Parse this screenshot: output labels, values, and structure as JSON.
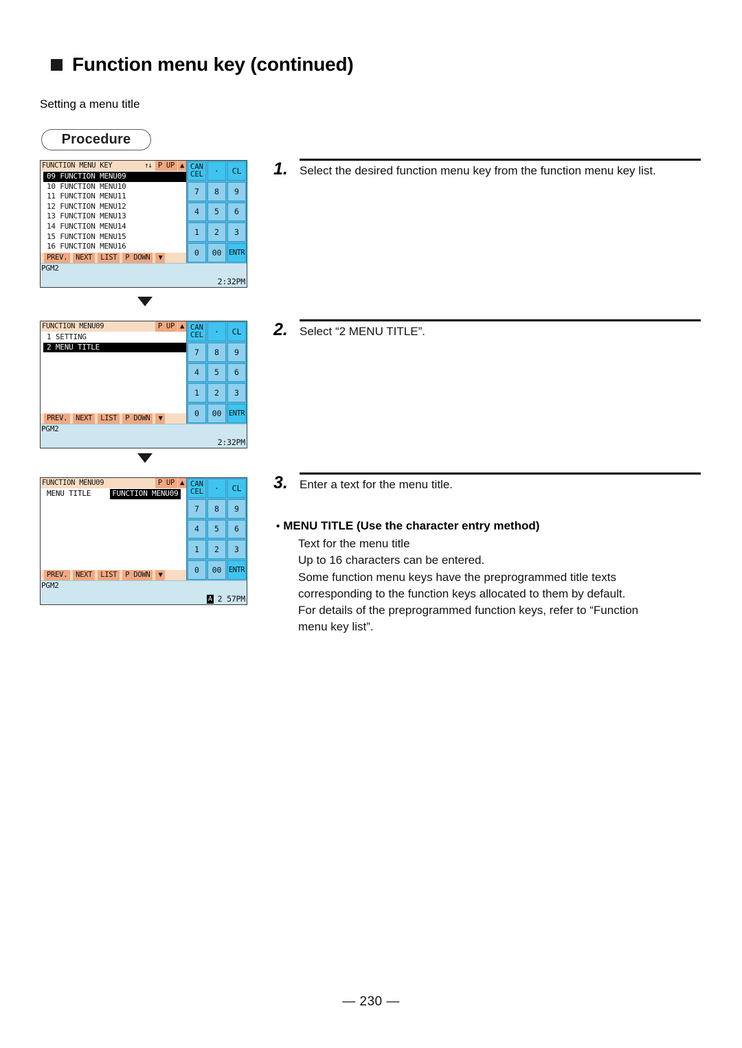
{
  "page": {
    "heading": "Function menu key (continued)",
    "subheading": "Setting a menu title",
    "procedure_label": "Procedure",
    "footer": "— 230 —"
  },
  "colors": {
    "header_bar": "#f7dcc2",
    "header_button": "#f0a882",
    "keypad_key": "#8ed0ee",
    "keypad_key_bright": "#3fc4f0",
    "status_bar": "#cde6f0",
    "selection": "#000000"
  },
  "keypad": {
    "rows": [
      [
        {
          "label_top": "CAN",
          "label_bottom": "CEL",
          "style": "bright",
          "name": "cancel-key"
        },
        {
          "label": "·",
          "style": "bright",
          "name": "decimal-key"
        },
        {
          "label": "CL",
          "style": "bright",
          "name": "clear-key"
        }
      ],
      [
        {
          "label": "7",
          "style": "normal",
          "name": "key-7"
        },
        {
          "label": "8",
          "style": "normal",
          "name": "key-8"
        },
        {
          "label": "9",
          "style": "normal",
          "name": "key-9"
        }
      ],
      [
        {
          "label": "4",
          "style": "normal",
          "name": "key-4"
        },
        {
          "label": "5",
          "style": "normal",
          "name": "key-5"
        },
        {
          "label": "6",
          "style": "normal",
          "name": "key-6"
        }
      ],
      [
        {
          "label": "1",
          "style": "normal",
          "name": "key-1"
        },
        {
          "label": "2",
          "style": "normal",
          "name": "key-2"
        },
        {
          "label": "3",
          "style": "normal",
          "name": "key-3"
        }
      ],
      [
        {
          "label": "0",
          "style": "normal",
          "name": "key-0"
        },
        {
          "label": "00",
          "style": "normal",
          "name": "key-00"
        },
        {
          "label": "ENTR",
          "style": "bright",
          "name": "enter-key"
        }
      ]
    ]
  },
  "function_bar": {
    "buttons": [
      "PREV.",
      "NEXT",
      "LIST",
      "P DOWN",
      "▼"
    ]
  },
  "screens": [
    {
      "id": "screen-1",
      "header": {
        "title": "FUNCTION MENU KEY",
        "sort_arrows": "↑↓",
        "page_up": "P UP",
        "scroll_up": "▲"
      },
      "list": [
        {
          "text": "09 FUNCTION MENU09",
          "selected": true
        },
        {
          "text": "10 FUNCTION MENU10",
          "selected": false
        },
        {
          "text": "11 FUNCTION MENU11",
          "selected": false
        },
        {
          "text": "12 FUNCTION MENU12",
          "selected": false
        },
        {
          "text": "13 FUNCTION MENU13",
          "selected": false
        },
        {
          "text": "14 FUNCTION MENU14",
          "selected": false
        },
        {
          "text": "15 FUNCTION MENU15",
          "selected": false
        },
        {
          "text": "16 FUNCTION MENU16",
          "selected": false
        }
      ],
      "status": {
        "mode": "PGM2",
        "time": "2:32PM",
        "caps": ""
      }
    },
    {
      "id": "screen-2",
      "header": {
        "title": "FUNCTION MENU09",
        "sort_arrows": "",
        "page_up": "P UP",
        "scroll_up": "▲"
      },
      "list": [
        {
          "text": "1 SETTING",
          "selected": false
        },
        {
          "text": "2 MENU TITLE",
          "selected": true
        }
      ],
      "status": {
        "mode": "PGM2",
        "time": "2:32PM",
        "caps": ""
      }
    },
    {
      "id": "screen-3",
      "header": {
        "title": "FUNCTION MENU09",
        "sort_arrows": "",
        "page_up": "P UP",
        "scroll_up": "▲"
      },
      "field": {
        "label": "MENU TITLE",
        "value": "FUNCTION MENU09"
      },
      "status": {
        "mode": "PGM2",
        "time": "2 57PM",
        "caps": "A"
      }
    }
  ],
  "steps": [
    {
      "number": "1.",
      "text": "Select the desired function menu key from the function menu key list."
    },
    {
      "number": "2.",
      "text": "Select “2 MENU TITLE”."
    },
    {
      "number": "3.",
      "text": "Enter a text for the menu title.",
      "note_head": "MENU TITLE (Use the character entry method)",
      "note_bullet": "•",
      "note_lines": [
        "Text for the menu title",
        "Up to 16 characters can be entered.",
        "Some function menu keys have the preprogrammed title texts",
        "corresponding to the function keys allocated to them by default.",
        "For details of the preprogrammed function keys, refer to “Function",
        "menu key list”."
      ]
    }
  ]
}
